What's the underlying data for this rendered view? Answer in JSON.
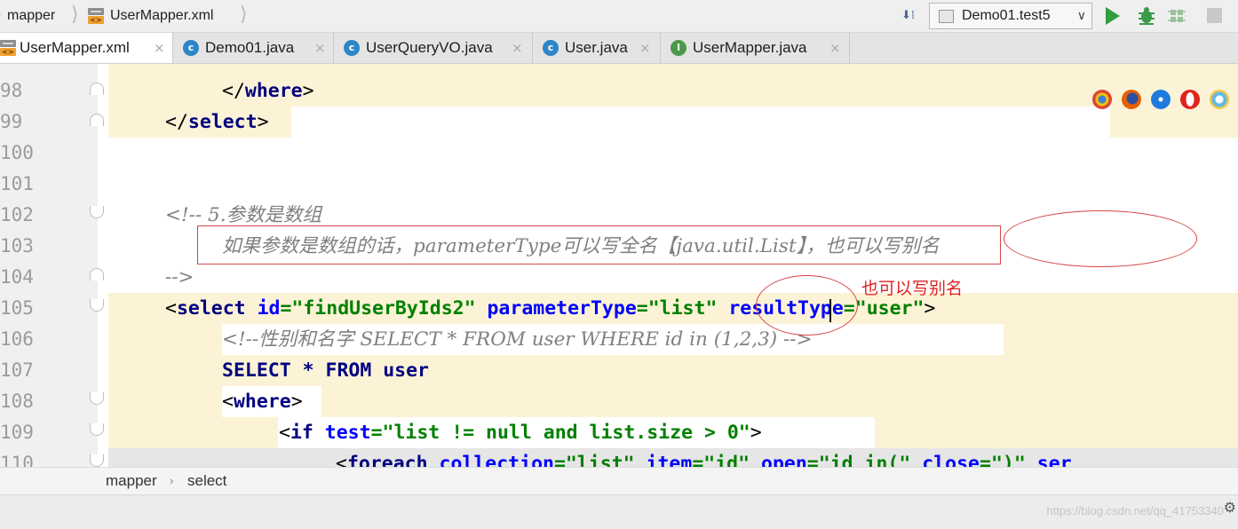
{
  "nav": {
    "crumbs": [
      "mapper",
      "UserMapper.xml"
    ],
    "run_config": "Demo01.test5"
  },
  "tabs": [
    {
      "label": "UserMapper.xml",
      "icon": "xml-file-icon",
      "active": true
    },
    {
      "label": "Demo01.java",
      "icon": "java-class-icon"
    },
    {
      "label": "UserQueryVO.java",
      "icon": "java-class-icon"
    },
    {
      "label": "User.java",
      "icon": "java-class-icon"
    },
    {
      "label": "UserMapper.java",
      "icon": "java-interface-icon"
    }
  ],
  "editor": {
    "line_numbers": [
      "98",
      "99",
      "100",
      "101",
      "102",
      "103",
      "104",
      "105",
      "106",
      "107",
      "108",
      "109",
      "110"
    ],
    "lines": {
      "l98": {
        "lt": "</",
        "tag": "where",
        "gt": ">"
      },
      "l99": {
        "lt": "</",
        "tag": "select",
        "gt": ">"
      },
      "l102": "<!-- 5.参数是数组",
      "l103": "如果参数是数组的话，parameterType可以写全名【java.util.List】，也可以写别名",
      "l104": "-->",
      "l105": {
        "lt": "<",
        "tag": "select",
        "a1": "id",
        "v1": "\"findUserByIds2\"",
        "a2": "parameterType",
        "v2": "\"list\"",
        "a3": "resultType",
        "v3": "\"user\"",
        "gt": ">"
      },
      "l106": "<!--性别和名字 SELECT * FROM user WHERE id in (1,2,3) -->",
      "l107": "SELECT * FROM user",
      "l108": {
        "lt": "<",
        "tag": "where",
        "gt": ">"
      },
      "l109": {
        "lt": "<",
        "tag": "if",
        "a1": "test",
        "v1": "\"list != null and list.size > 0\"",
        "gt": ">"
      },
      "l110": {
        "lt": "<",
        "tag": "foreach",
        "a1": "collection",
        "v1": "\"list\"",
        "a2": "item",
        "v2": "\"id\"",
        "a3": "open",
        "v3": "\"id in(\"",
        "a4": "close",
        "v4": "\")\"",
        "a5": "ser"
      }
    }
  },
  "annotation": {
    "alias_note": "也可以写别名"
  },
  "breadcrumb": [
    "mapper",
    "select"
  ],
  "watermark": "https://blog.csdn.net/qq_41753340",
  "colors": {
    "tag": "#000080",
    "attr": "#0000ff",
    "value": "#008000",
    "comment": "#808080",
    "highlight": "#fcf3d6",
    "annotation": "#d64545"
  }
}
